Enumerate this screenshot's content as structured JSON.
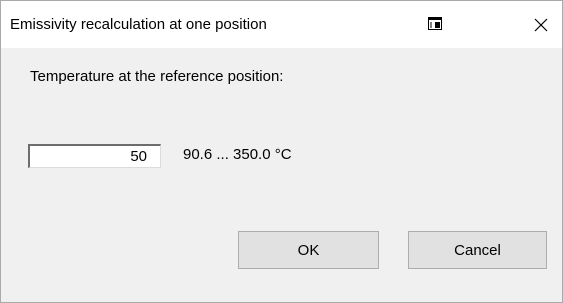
{
  "window": {
    "title": "Emissivity recalculation at one position",
    "title_icon": "window-snap-icon",
    "close_icon": "close-icon"
  },
  "dialog": {
    "prompt": "Temperature at the reference position:",
    "temperature_value": "50",
    "range_text": "90.6 ... 350.0 °C",
    "ok_label": "OK",
    "cancel_label": "Cancel"
  }
}
